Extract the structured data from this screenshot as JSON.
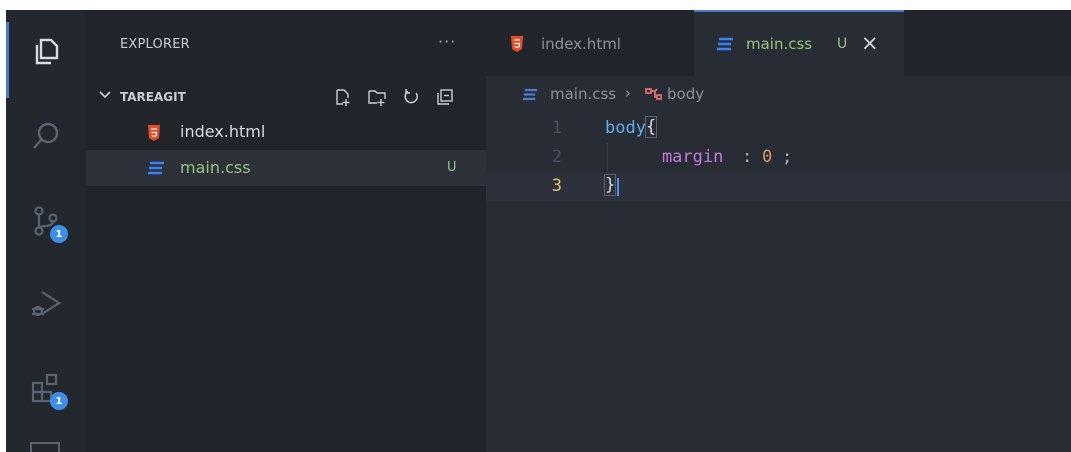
{
  "colors": {
    "activity_bg": "#23272e",
    "sidebar_bg": "#21252b",
    "editor_bg": "#282c34",
    "accent": "#4d78cc",
    "html_icon": "#e44d26",
    "css_icon": "#3b82f6",
    "untracked_green": "#98c379",
    "keyword": "#c678dd",
    "selector": "#e06c75",
    "number": "#d19a66"
  },
  "activity_bar": {
    "items": [
      {
        "name": "explorer",
        "icon": "files-icon"
      },
      {
        "name": "search",
        "icon": "search-icon"
      },
      {
        "name": "source-control",
        "icon": "source-control-icon",
        "badge": "1"
      },
      {
        "name": "run-debug",
        "icon": "run-debug-icon"
      },
      {
        "name": "extensions",
        "icon": "extensions-icon",
        "badge": "1"
      }
    ]
  },
  "sidebar": {
    "title": "EXPLORER",
    "more": "···",
    "folder": {
      "name": "TAREAGIT",
      "actions": [
        "new-file-icon",
        "new-folder-icon",
        "refresh-icon",
        "collapse-all-icon"
      ]
    },
    "files": [
      {
        "name": "index.html",
        "type": "html",
        "status": "",
        "selected": false
      },
      {
        "name": "main.css",
        "type": "css",
        "status": "U",
        "selected": true
      }
    ]
  },
  "tabs": [
    {
      "label": "index.html",
      "type": "html",
      "active": false
    },
    {
      "label": "main.css",
      "type": "css",
      "status": "U",
      "active": true,
      "close": "×"
    }
  ],
  "breadcrumb": {
    "file": "main.css",
    "separator": "›",
    "symbol": "body"
  },
  "code": {
    "lines": [
      {
        "number": "1",
        "tokens": [
          {
            "t": "body",
            "c": "#61afef"
          },
          {
            "t": "{",
            "c": "#d7dae0"
          }
        ]
      },
      {
        "number": "2",
        "tokens": [
          {
            "t": "    margin",
            "c": "#c678dd"
          },
          {
            "t": ": ",
            "c": "#abb2bf"
          },
          {
            "t": "0",
            "c": "#d19a66"
          },
          {
            "t": ";",
            "c": "#abb2bf"
          }
        ]
      },
      {
        "number": "3",
        "tokens": [
          {
            "t": "}",
            "c": "#d7dae0"
          }
        ],
        "current": true
      }
    ]
  }
}
